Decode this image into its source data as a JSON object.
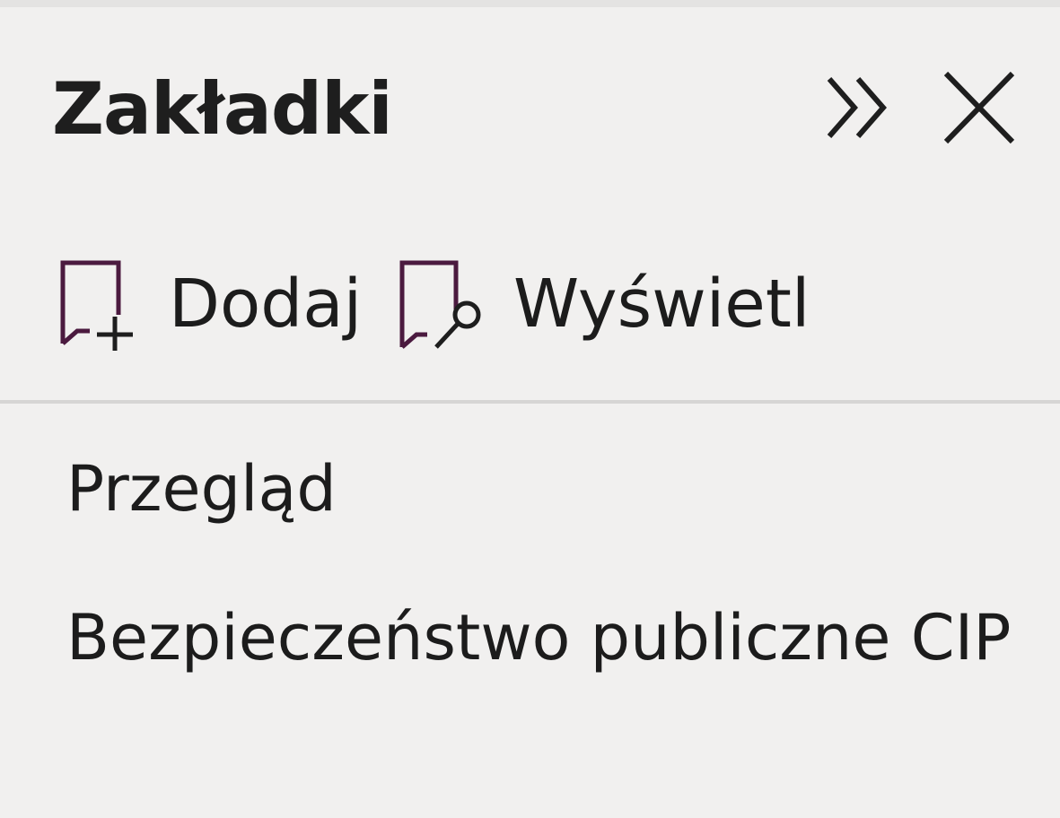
{
  "panel": {
    "title": "Zakładki",
    "expand_icon": "double-chevron-right-icon",
    "close_icon": "close-icon"
  },
  "toolbar": {
    "add_label": "Dodaj",
    "add_icon": "bookmark-add-icon",
    "view_label": "Wyświetl",
    "view_icon": "bookmark-search-icon"
  },
  "bookmarks": [
    {
      "label": "Przegląd"
    },
    {
      "label": "Bezpieczeństwo publiczne CIP"
    }
  ],
  "colors": {
    "background": "#f1f0ef",
    "text": "#1c1c1c",
    "icon_accent": "#4b1a3f",
    "divider": "#d6d5d4"
  }
}
